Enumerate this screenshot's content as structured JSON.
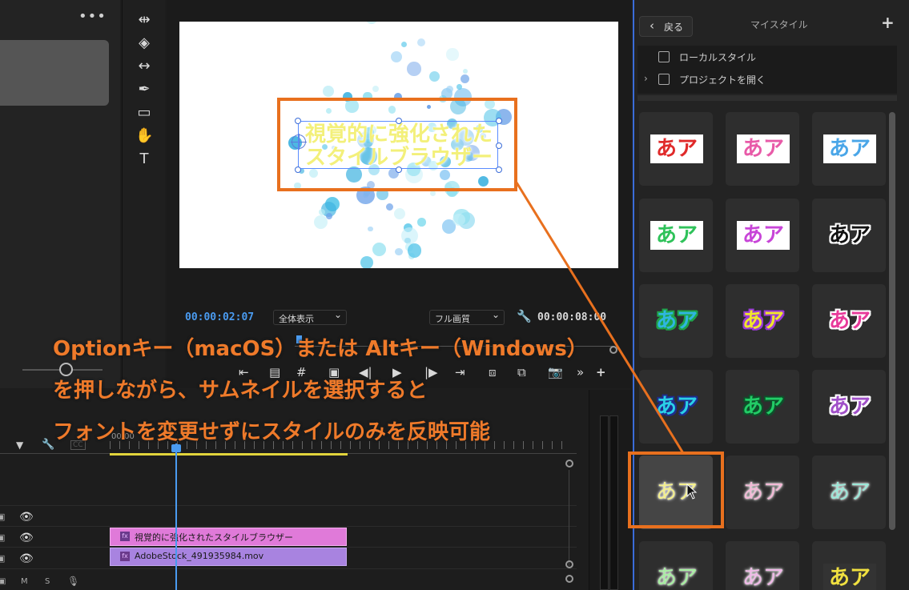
{
  "project_panel": {
    "more_icon": "ellipsis-icon"
  },
  "monitor": {
    "title_line1": "視覚的に強化された",
    "title_line2": "スタイルブラウザー",
    "timecode_current": "00:00:02:07",
    "fit_select": "全体表示",
    "quality_select": "フル画質",
    "timecode_duration": "00:00:08:00"
  },
  "timeline": {
    "ruler_label": "00:00",
    "clips": {
      "title_clip": "視覚的に強化されたスタイルブラウザー",
      "video_clip": "AdobeStock_491935984.mov"
    },
    "fx_badge": "fx",
    "track_labels": [
      "M",
      "S"
    ]
  },
  "right_panel": {
    "back_label": "戻る",
    "title": "マイスタイル",
    "add_icon": "+",
    "options": [
      {
        "label": "ローカルスタイル"
      },
      {
        "label": "プロジェクトを開く"
      }
    ],
    "styles": [
      {
        "text": "あア",
        "fill": "#e02a2a",
        "bg": "#ffffff",
        "outline": "none"
      },
      {
        "text": "あア",
        "fill": "#e85aa8",
        "bg": "#ffffff",
        "outline": "none"
      },
      {
        "text": "あア",
        "fill": "#4aa6e8",
        "bg": "#ffffff",
        "outline": "none"
      },
      {
        "text": "あア",
        "fill": "#2fc25a",
        "bg": "#ffffff",
        "outline": "none"
      },
      {
        "text": "あア",
        "fill": "#c845d8",
        "bg": "#ffffff",
        "outline": "none"
      },
      {
        "text": "あア",
        "fill": "#111111",
        "bg": "none",
        "outline": "#ffffff"
      },
      {
        "text": "あア",
        "fill": "#2fb6e0",
        "bg": "none",
        "outline": "#1fa34a"
      },
      {
        "text": "あア",
        "fill": "#f0e72a",
        "bg": "none",
        "outline": "#9a3ad8"
      },
      {
        "text": "あア",
        "fill": "#e83a9a",
        "bg": "none",
        "outline": "#ffffff"
      },
      {
        "text": "あア",
        "fill": "#2ad0e8",
        "bg": "none",
        "outline": "#1e2c8c"
      },
      {
        "text": "あア",
        "fill": "#22cc66",
        "bg": "none",
        "outline": "#0e4f2a"
      },
      {
        "text": "あア",
        "fill": "#a050c8",
        "bg": "none",
        "outline": "#ffffff"
      },
      {
        "text": "あア",
        "fill": "#f5f08a",
        "bg": "none",
        "outline": "glow"
      },
      {
        "text": "あア",
        "fill": "#f4b8d6",
        "bg": "none",
        "outline": "glow"
      },
      {
        "text": "あア",
        "fill": "#9ae8d8",
        "bg": "none",
        "outline": "glow"
      },
      {
        "text": "あア",
        "fill": "#a6f0a0",
        "bg": "none",
        "outline": "glow"
      },
      {
        "text": "あア",
        "fill": "#f0b8e8",
        "bg": "none",
        "outline": "glow"
      },
      {
        "text": "あア",
        "fill": "#f0e040",
        "bg": "#333333",
        "outline": "none"
      }
    ]
  },
  "annotation": {
    "line1": "Optionキー（macOS）または Altキー（Windows）",
    "line2": "を押しながら、サムネイルを選択すると",
    "line3": "フォントを変更せずにスタイルのみを反映可能",
    "color": "#e8701e"
  }
}
